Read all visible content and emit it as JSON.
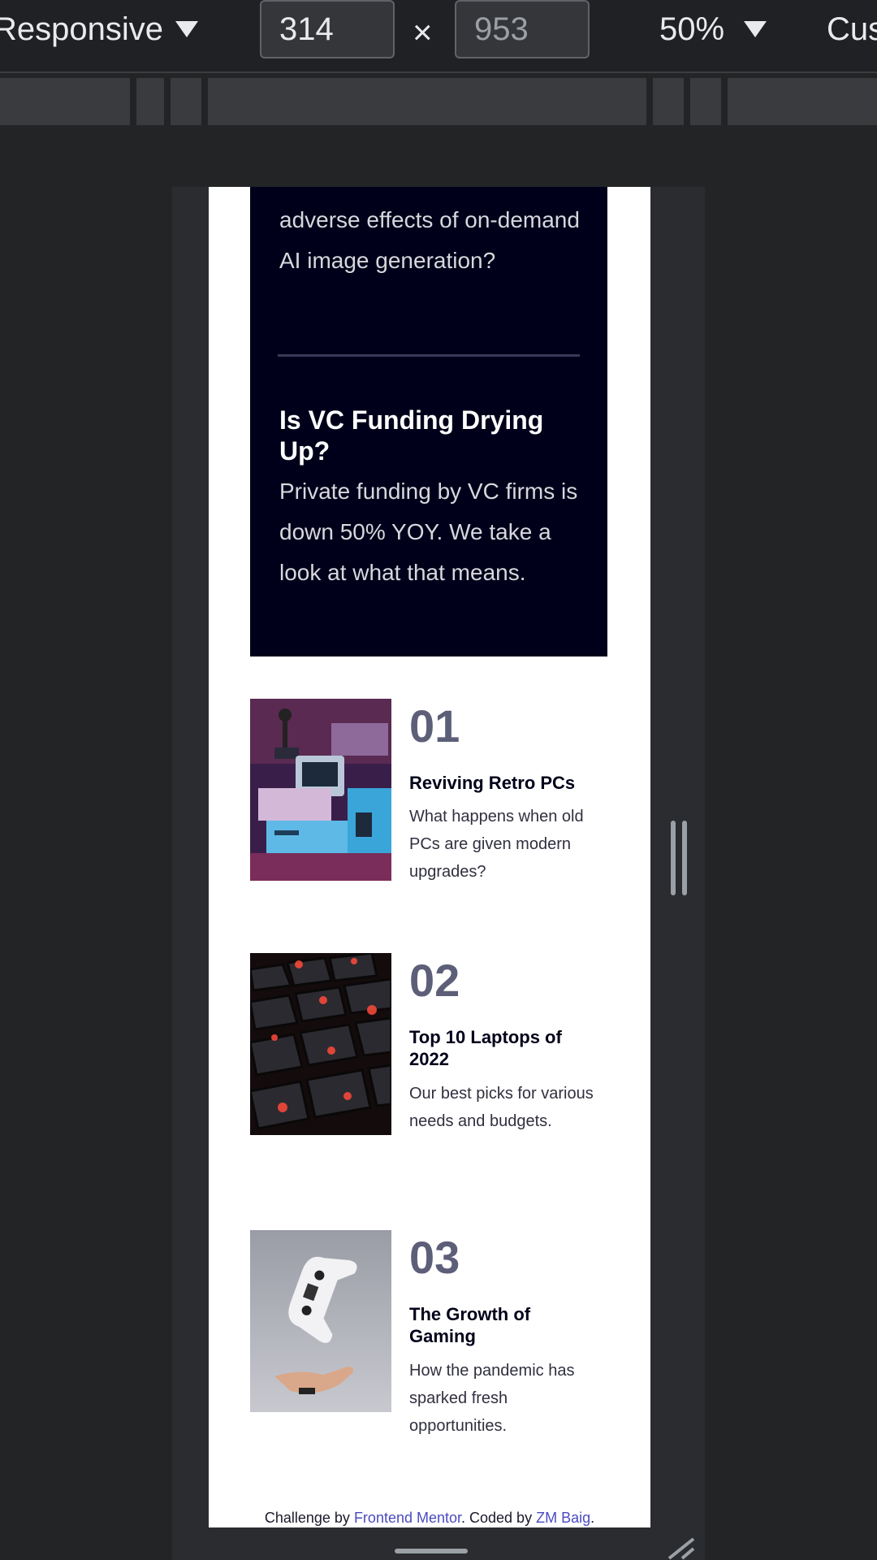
{
  "toolbar": {
    "device": "Responsive",
    "width": "314",
    "height": "953",
    "times": "×",
    "zoom": "50%",
    "throttle": "Cus"
  },
  "card": {
    "partial_text": "adverse effects of on-demand AI image generation?",
    "title": "Is VC Funding Drying Up?",
    "text": "Private funding by VC firms is down 50% YOY. We take a look at what that means."
  },
  "articles": [
    {
      "num": "01",
      "title": "Reviving Retro PCs",
      "desc": "What happens when old PCs are given modern upgrades?"
    },
    {
      "num": "02",
      "title": "Top 10 Laptops of 2022",
      "desc": "Our best picks for various needs and budgets."
    },
    {
      "num": "03",
      "title": "The Growth of Gaming",
      "desc": "How the pandemic has sparked fresh opportunities."
    }
  ],
  "attribution": {
    "prefix": "Challenge by ",
    "link1": "Frontend Mentor",
    "middle": ". Coded by ",
    "link2": "ZM Baig",
    "suffix": "."
  },
  "colors": {
    "dark_navy": "#00001a",
    "number_gray": "#5d5f79",
    "link_blue": "#4b4bc0"
  }
}
